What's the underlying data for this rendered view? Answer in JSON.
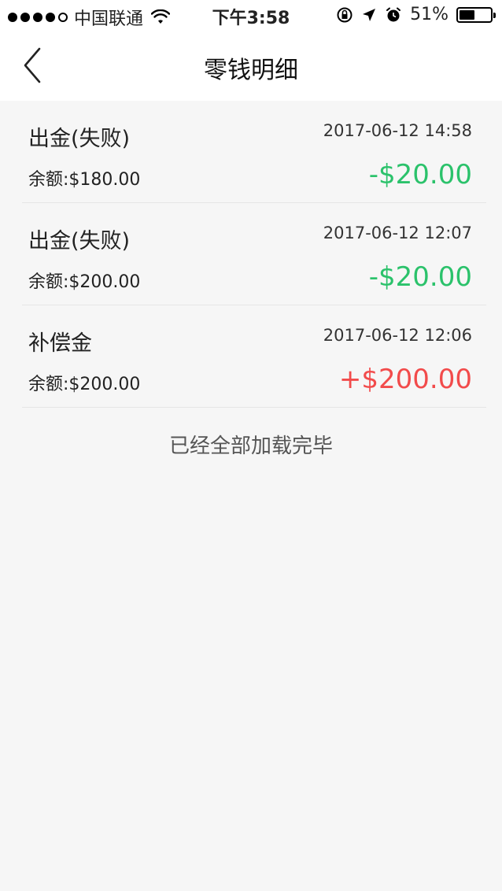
{
  "status_bar": {
    "carrier": "中国联通",
    "time": "下午3:58",
    "battery_percent": "51%",
    "battery_level": 0.51,
    "signal_bars": 4
  },
  "nav": {
    "title": "零钱明细"
  },
  "transactions": [
    {
      "type": "出金(失败)",
      "datetime": "2017-06-12 14:58",
      "balance_label": "余额:",
      "balance": "$180.00",
      "amount": "-$20.00",
      "amount_color": "#2bc26b"
    },
    {
      "type": "出金(失败)",
      "datetime": "2017-06-12 12:07",
      "balance_label": "余额:",
      "balance": "$200.00",
      "amount": "-$20.00",
      "amount_color": "#2bc26b"
    },
    {
      "type": "补偿金",
      "datetime": "2017-06-12 12:06",
      "balance_label": "余额:",
      "balance": "$200.00",
      "amount": "+$200.00",
      "amount_color": "#f24b4b"
    }
  ],
  "footer": {
    "loaded_text": "已经全部加载完毕"
  }
}
